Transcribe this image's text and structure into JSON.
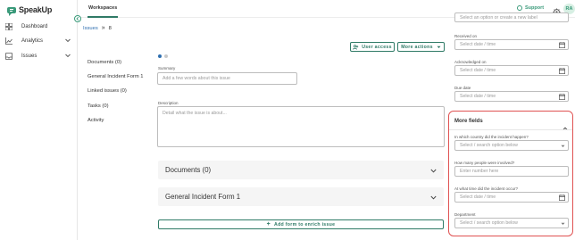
{
  "app": {
    "name": "SpeakUp"
  },
  "sidebar": {
    "collapse_icon": "chevron-left-icon",
    "items": [
      {
        "label": "Dashboard",
        "icon": "grid-icon"
      },
      {
        "label": "Analytics",
        "icon": "chart-icon"
      },
      {
        "label": "Issues",
        "icon": "issues-icon"
      }
    ]
  },
  "topbar": {
    "tab": "Workspaces",
    "support_label": "Support",
    "avatar_initials": "RA"
  },
  "breadcrumb": {
    "root": "Issues",
    "current": "8"
  },
  "actions": {
    "user_access": "User access",
    "more_actions": "More actions"
  },
  "side_links": [
    "Documents (0)",
    "General Incident Form 1",
    "Linked issues (0)",
    "Tasks (0)",
    "Activity"
  ],
  "form": {
    "summary_label": "Summary",
    "summary_placeholder": "Add a few words about this issue",
    "description_label": "Description",
    "description_placeholder": "Detail what the issue is about..."
  },
  "sections": {
    "documents": "Documents (0)",
    "general_form": "General Incident Form 1"
  },
  "add_form_label": "Add form to enrich issue",
  "right_panel": {
    "top_placeholder": "Select an option or create a new label",
    "received_on_label": "Received on",
    "acknowledged_on_label": "Acknowledged on",
    "due_date_label": "Due date",
    "date_placeholder": "Select date / time",
    "more_fields_title": "More fields",
    "country_label": "In which country did the incident happen?",
    "country_placeholder": "Select / search option below",
    "people_label": "How many people were involved?",
    "people_placeholder": "Enter number here",
    "time_label": "At what time did the incident occur?",
    "time_placeholder": "Select date / time",
    "department_label": "Department",
    "department_placeholder": "Select / search option below"
  },
  "colors": {
    "accent": "#2f7a66",
    "highlight_border": "#e05252",
    "link": "#2f6fb0",
    "dot_active": "#2f6fb0",
    "dot_inactive": "#c9c9c9"
  }
}
